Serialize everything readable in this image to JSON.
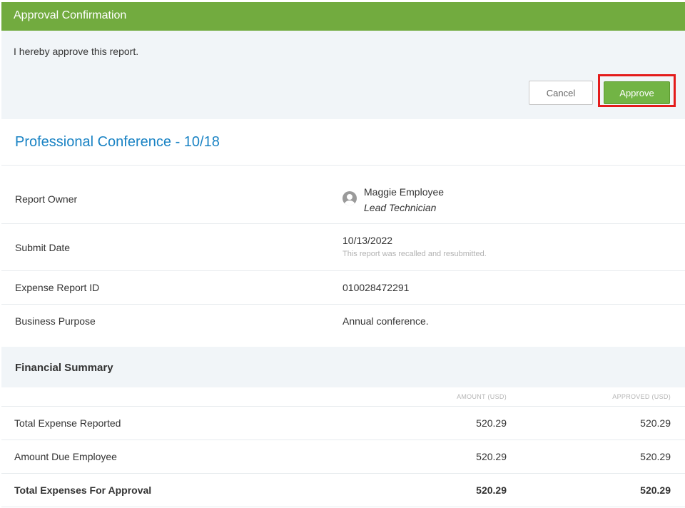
{
  "header": {
    "title": "Approval Confirmation"
  },
  "confirm": {
    "text": "I hereby approve this report.",
    "cancel_label": "Cancel",
    "approve_label": "Approve"
  },
  "report": {
    "title": "Professional Conference - 10/18",
    "fields": {
      "owner_label": "Report Owner",
      "owner_name": "Maggie Employee",
      "owner_role": "Lead Technician",
      "submit_label": "Submit Date",
      "submit_value": "10/13/2022",
      "submit_note": "This report was recalled and resubmitted.",
      "id_label": "Expense Report ID",
      "id_value": "010028472291",
      "purpose_label": "Business Purpose",
      "purpose_value": "Annual conference."
    }
  },
  "financial": {
    "title": "Financial Summary",
    "columns": [
      "AMOUNT (USD)",
      "APPROVED (USD)"
    ],
    "rows": [
      {
        "label": "Total Expense Reported",
        "amount": "520.29",
        "approved": "520.29"
      },
      {
        "label": "Amount Due Employee",
        "amount": "520.29",
        "approved": "520.29"
      },
      {
        "label": "Total Expenses For Approval",
        "amount": "520.29",
        "approved": "520.29"
      }
    ]
  },
  "colors": {
    "header_green": "#72ab3f",
    "approve_green": "#72b445",
    "highlight_red": "#e41b1b",
    "title_blue": "#1a83c4",
    "panel_bg": "#f1f5f8"
  },
  "icons": {
    "owner_avatar": "user-avatar-icon"
  }
}
